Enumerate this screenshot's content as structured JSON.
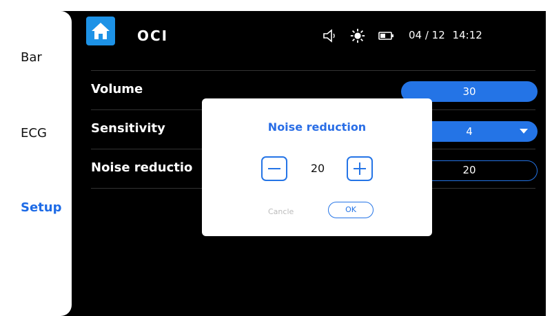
{
  "sidebar": {
    "items": [
      {
        "label": "Bar"
      },
      {
        "label": "ECG"
      },
      {
        "label": "Setup"
      }
    ]
  },
  "header": {
    "title": "OCI",
    "date": "04 / 12",
    "time": "14:12"
  },
  "settings": {
    "volume": {
      "label": "Volume",
      "value": "30"
    },
    "sensitivity": {
      "label": "Sensitivity",
      "value": "4"
    },
    "noise_reduction": {
      "label": "Noise reductio",
      "value": "20"
    }
  },
  "dialog": {
    "title": "Noise reduction",
    "value": "20",
    "cancel_label": "Cancle",
    "ok_label": "OK"
  },
  "colors": {
    "accent": "#2474e6",
    "home_bg": "#1d92e6",
    "screen_bg": "#000000"
  },
  "icons": [
    "home-icon",
    "speaker-icon",
    "brightness-icon",
    "battery-icon",
    "minus-icon",
    "plus-icon",
    "dropdown-arrow-icon"
  ]
}
